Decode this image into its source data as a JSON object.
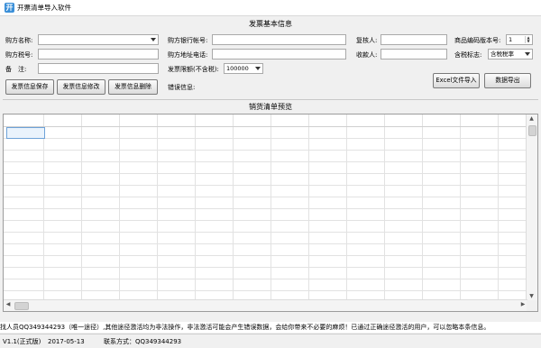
{
  "window": {
    "title": "开票清单导入软件"
  },
  "invoice_info": {
    "section_title": "发票基本信息",
    "buyer_name_label": "购方名称:",
    "buyer_name_value": "",
    "buyer_tax_label": "购方税号:",
    "buyer_tax_value": "",
    "remark_label": "备　注:",
    "remark_value": "",
    "bank_account_label": "购方银行帐号:",
    "bank_account_value": "",
    "address_phone_label": "购方地址电话:",
    "address_phone_value": "",
    "limit_label": "发票限额(不含税):",
    "limit_value": "100000",
    "error_label": "错误信息:",
    "reviewer_label": "复核人:",
    "reviewer_value": "",
    "payee_label": "收款人:",
    "payee_value": "",
    "code_version_label": "商品编码版本号:",
    "code_version_value": "1",
    "tax_flag_label": "含税标志:",
    "tax_flag_value": "含税税率"
  },
  "buttons": {
    "save": "发票信息保存",
    "modify": "发票信息修改",
    "delete": "发票信息删除",
    "excel_import": "Excel文件导入",
    "export": "数据导出"
  },
  "sales_list": {
    "title": "销货清单预览"
  },
  "notice": "找人员QQ349344293（唯一途径）,其他途径激活均为非法操作，非法激活可能会产生错误数据，会给你带来不必要的麻烦！已通过正确途径激活的用户，可以忽略本条信息。",
  "status": {
    "version": "V1.1(正式版)",
    "date": "2017-05-13",
    "contact": "联系方式：QQ349344293"
  },
  "colors": {
    "app_icon": "#3a8fd8",
    "selection_border": "#6ea2d8"
  }
}
